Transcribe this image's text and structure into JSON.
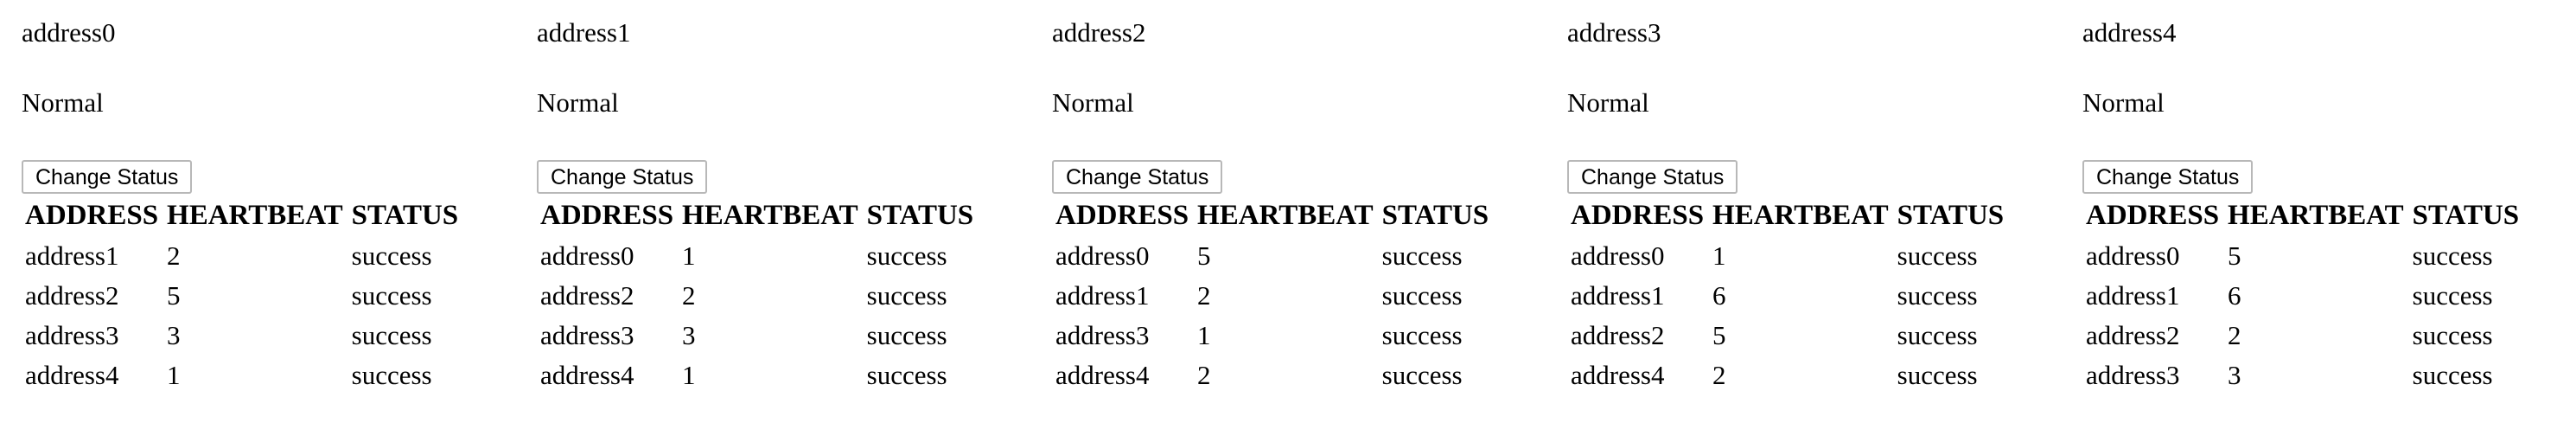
{
  "nodes": [
    {
      "address": "address0",
      "state": "Normal",
      "button_label": "Change Status",
      "headers": [
        "ADDRESS",
        "HEARTBEAT",
        "STATUS"
      ],
      "rows": [
        [
          "address1",
          "2",
          "success"
        ],
        [
          "address2",
          "5",
          "success"
        ],
        [
          "address3",
          "3",
          "success"
        ],
        [
          "address4",
          "1",
          "success"
        ]
      ]
    },
    {
      "address": "address1",
      "state": "Normal",
      "button_label": "Change Status",
      "headers": [
        "ADDRESS",
        "HEARTBEAT",
        "STATUS"
      ],
      "rows": [
        [
          "address0",
          "1",
          "success"
        ],
        [
          "address2",
          "2",
          "success"
        ],
        [
          "address3",
          "3",
          "success"
        ],
        [
          "address4",
          "1",
          "success"
        ]
      ]
    },
    {
      "address": "address2",
      "state": "Normal",
      "button_label": "Change Status",
      "headers": [
        "ADDRESS",
        "HEARTBEAT",
        "STATUS"
      ],
      "rows": [
        [
          "address0",
          "5",
          "success"
        ],
        [
          "address1",
          "2",
          "success"
        ],
        [
          "address3",
          "1",
          "success"
        ],
        [
          "address4",
          "2",
          "success"
        ]
      ]
    },
    {
      "address": "address3",
      "state": "Normal",
      "button_label": "Change Status",
      "headers": [
        "ADDRESS",
        "HEARTBEAT",
        "STATUS"
      ],
      "rows": [
        [
          "address0",
          "1",
          "success"
        ],
        [
          "address1",
          "6",
          "success"
        ],
        [
          "address2",
          "5",
          "success"
        ],
        [
          "address4",
          "2",
          "success"
        ]
      ]
    },
    {
      "address": "address4",
      "state": "Normal",
      "button_label": "Change Status",
      "headers": [
        "ADDRESS",
        "HEARTBEAT",
        "STATUS"
      ],
      "rows": [
        [
          "address0",
          "5",
          "success"
        ],
        [
          "address1",
          "6",
          "success"
        ],
        [
          "address2",
          "2",
          "success"
        ],
        [
          "address3",
          "3",
          "success"
        ]
      ]
    }
  ]
}
